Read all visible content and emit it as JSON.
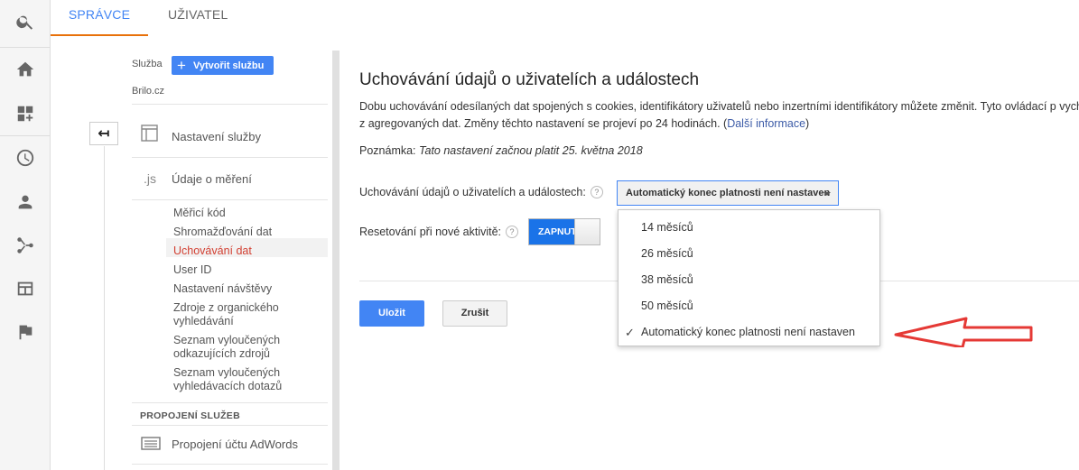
{
  "tabs": {
    "admin": "SPRÁVCE",
    "user": "UŽIVATEL"
  },
  "nav": {
    "property_label": "Služba",
    "create_button": "Vytvořit službu",
    "property_name": "Brilo.cz",
    "section_settings": "Nastavení služby",
    "section_tracking_icon": ".js",
    "section_tracking": "Údaje o měření",
    "sub_items": [
      "Měřicí kód",
      "Shromažďování dat",
      "Uchovávání dat",
      "User ID",
      "Nastavení návštěvy",
      "Zdroje z organického vyhledávání",
      "Seznam vyloučených odkazujících zdrojů",
      "Seznam vyloučených vyhledávacích dotazů"
    ],
    "linking_header": "PROPOJENÍ SLUŽEB",
    "adwords_link": "Propojení účtu AdWords"
  },
  "main": {
    "title": "Uchovávání údajů o uživatelích a událostech",
    "description": "Dobu uchovávání odesílaných dat spojených s cookies, identifikátory uživatelů nebo inzertními identifikátory můžete změnit. Tyto ovládací p vycházejí z agregovaných dat. Změny těchto nastavení se projeví po 24 hodinách. (",
    "more_info": "Další informace",
    "desc_close": ")",
    "note_label": "Poznámka:",
    "note_text": "Tato nastavení začnou platit 25. května 2018",
    "retention_label": "Uchovávání údajů o uživatelích a událostech:",
    "retention_value": "Automatický konec platnosti není nastaven",
    "reset_label": "Resetování při nové aktivitě:",
    "toggle_on": "ZAPNUTO",
    "save": "Uložit",
    "cancel": "Zrušit"
  },
  "dropdown": {
    "options": [
      "14 měsíců",
      "26 měsíců",
      "38 měsíců",
      "50 měsíců",
      "Automatický konec platnosti není nastaven"
    ],
    "selected_index": 4
  },
  "colors": {
    "accent": "#4285f4",
    "tab_underline": "#e8710a",
    "active_nav": "#d23f31",
    "annotation_arrow": "#e53935"
  }
}
